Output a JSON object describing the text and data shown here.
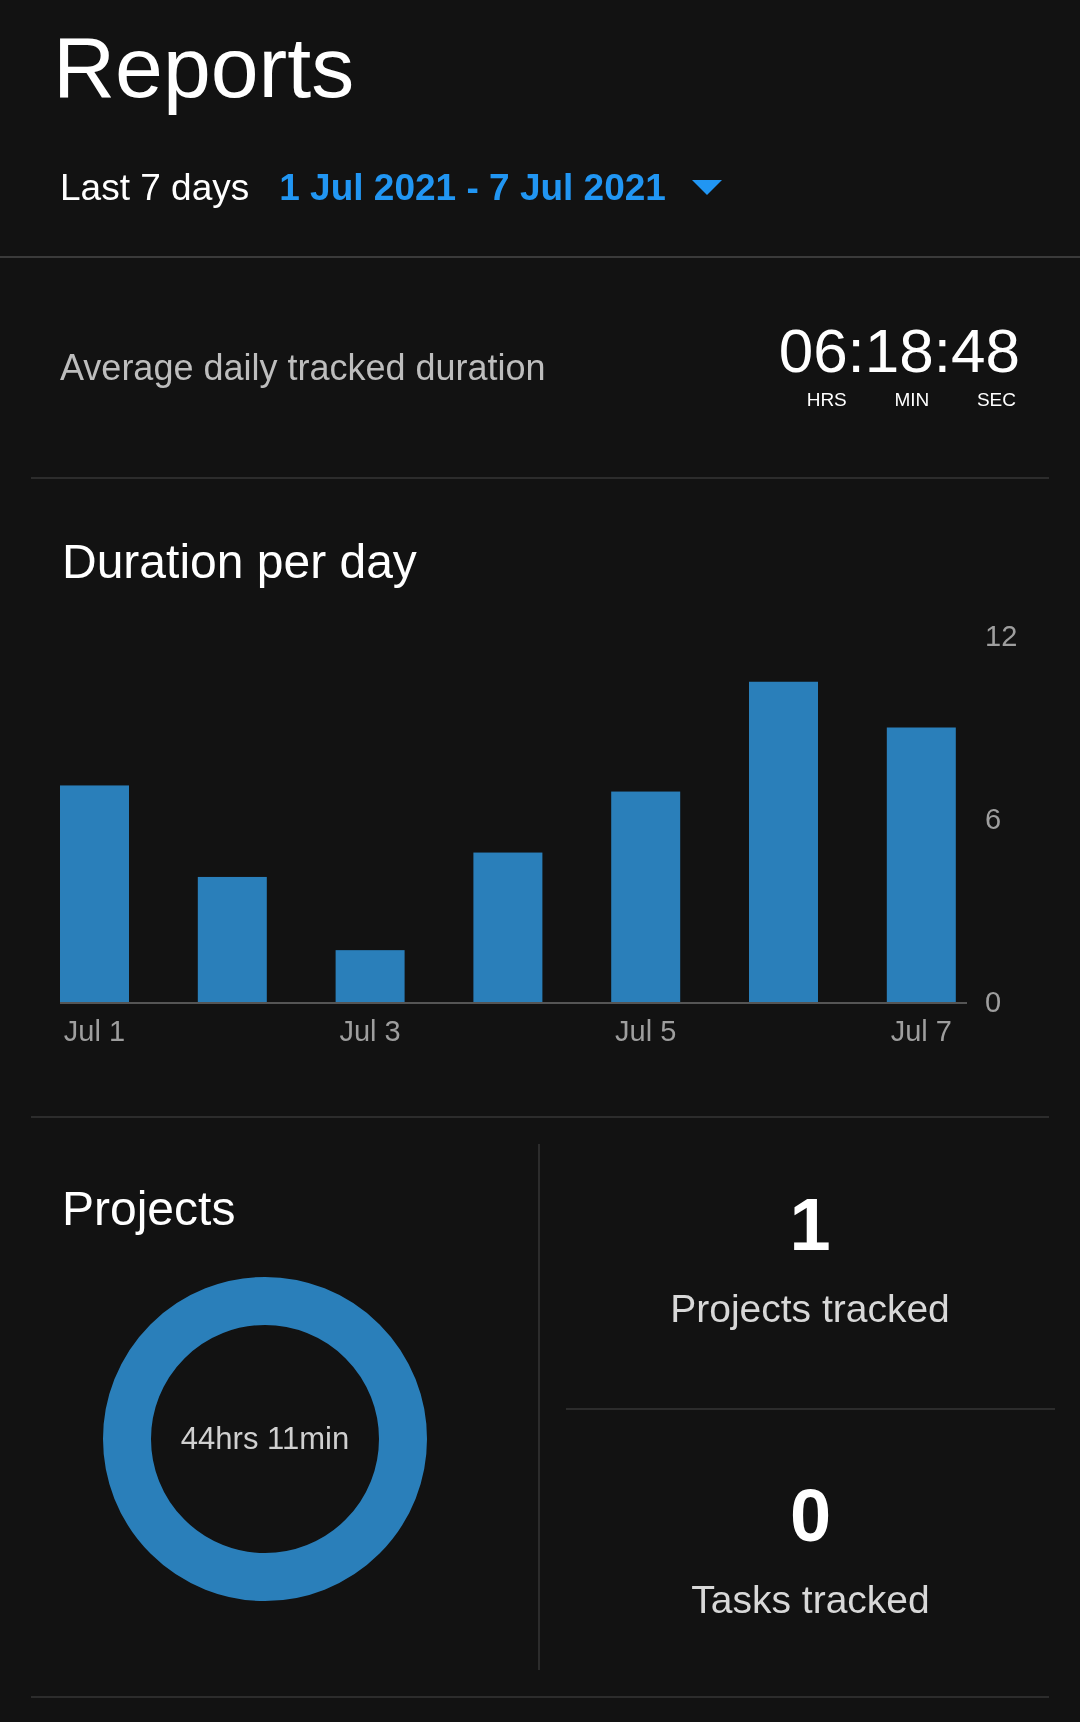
{
  "header": {
    "title": "Reports"
  },
  "range": {
    "preset": "Last 7 days",
    "dates": "1 Jul 2021 - 7 Jul 2021"
  },
  "average": {
    "label": "Average daily tracked duration",
    "time": "06:18:48",
    "units": [
      "HRS",
      "MIN",
      "SEC"
    ]
  },
  "duration_chart": {
    "title": "Duration per day",
    "chart_data": {
      "type": "bar",
      "categories": [
        "Jul 1",
        null,
        "Jul 3",
        null,
        "Jul 5",
        null,
        "Jul 7"
      ],
      "series": [
        {
          "color": "#2a7fba",
          "values": [
            7.1,
            4.1,
            1.7,
            4.9,
            6.9,
            10.5,
            9.0
          ]
        }
      ],
      "ylim": [
        0,
        12
      ],
      "yticks": [
        0,
        6,
        12
      ]
    }
  },
  "projects": {
    "title": "Projects",
    "total": "44hrs 11min"
  },
  "stats": [
    {
      "value": "1",
      "label": "Projects tracked"
    },
    {
      "value": "0",
      "label": "Tasks tracked"
    }
  ]
}
